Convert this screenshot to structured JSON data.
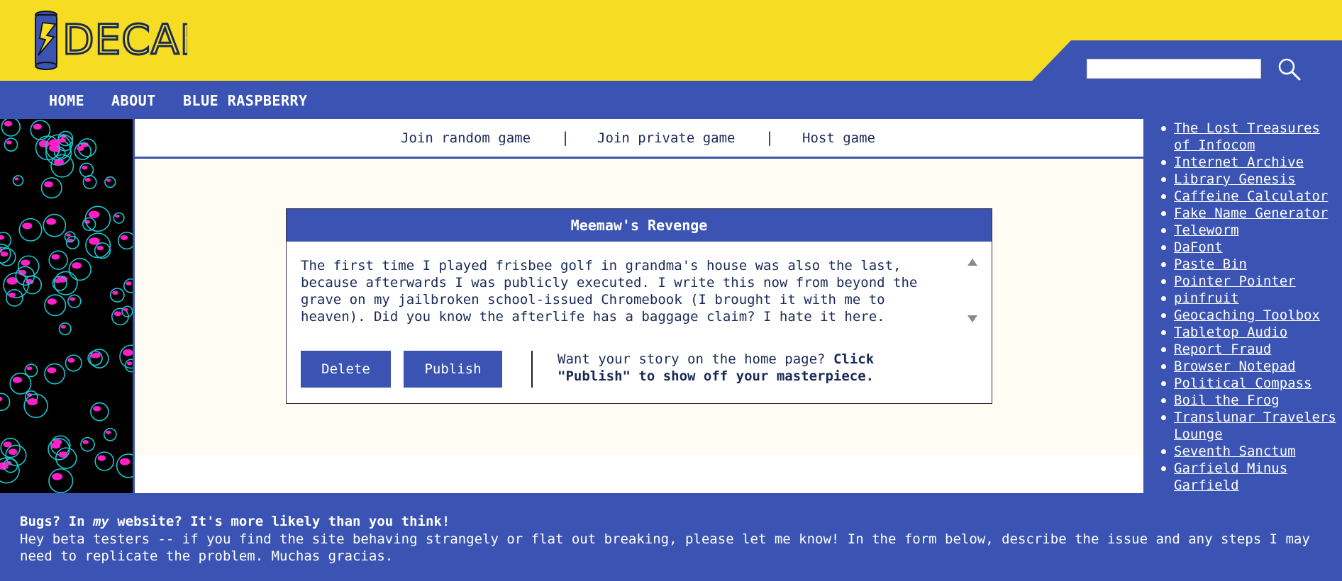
{
  "site": {
    "logo_text": "DECAF"
  },
  "search": {
    "placeholder": ""
  },
  "nav": {
    "items": [
      "HOME",
      "ABOUT",
      "BLUE RASPBERRY"
    ]
  },
  "subnav": {
    "items": [
      "Join random game",
      "Join private game",
      "Host game"
    ],
    "separator": "|"
  },
  "story_card": {
    "title": "Meemaw's Revenge",
    "text": "The first time I played frisbee golf in grandma's house was also the last,\nbecause afterwards I was publicly executed. I write this now from beyond the\ngrave on my jailbroken school-issued Chromebook (I brought it with me to\nheaven). Did you know the afterlife has a baggage claim? I hate it here.",
    "delete_label": "Delete",
    "publish_label": "Publish",
    "hint_prefix": "Want your story on the home page? ",
    "hint_bold": "Click \"Publish\" to show off your masterpiece."
  },
  "sidebar": {
    "links": [
      "The Lost Treasures of Infocom",
      "Internet Archive",
      "Library Genesis",
      "Caffeine Calculator",
      "Fake Name Generator",
      "Teleworm",
      "DaFont",
      "Paste Bin",
      "Pointer Pointer",
      "pinfruit",
      "Geocaching Toolbox",
      "Tabletop Audio",
      "Report Fraud",
      "Browser Notepad",
      "Political Compass",
      "Boil the Frog",
      "Translunar Travelers Lounge",
      "Seventh Sanctum",
      "Garfield Minus Garfield"
    ]
  },
  "footer": {
    "title_before": "Bugs? In ",
    "title_em": "my",
    "title_after": " website? It's more likely than you think!",
    "body": "Hey beta testers -- if you find the site behaving strangely or flat out breaking, please let me know! In the form below, describe the issue and any steps I may need to replicate the problem. Muchas gracias."
  },
  "colors": {
    "header_yellow": "#f6dc22",
    "brand_blue": "#3b54b4",
    "content_bg": "#fffcf3",
    "text_navy": "#1a2a57",
    "bubble_cyan": "#19c6cf",
    "bubble_magenta": "#ff1fc8"
  },
  "icons": {
    "search": "magnifier-icon",
    "logo": "lightning-can-icon"
  }
}
